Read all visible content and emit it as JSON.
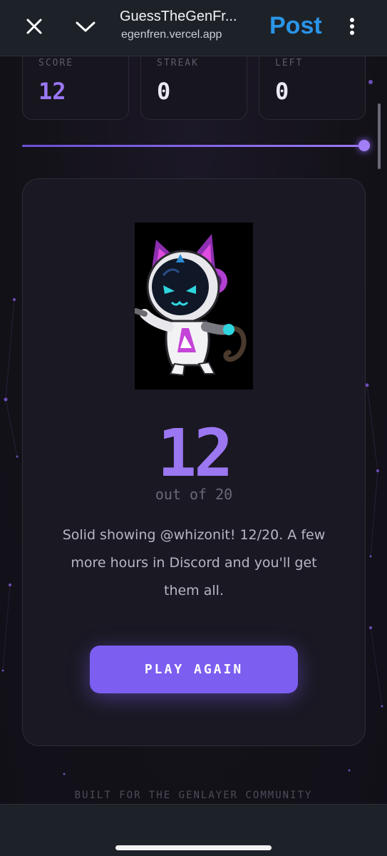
{
  "browser": {
    "title": "GuessTheGenFr...",
    "url": "egenfren.vercel.app",
    "post_label": "Post",
    "icons": [
      "close-icon",
      "chevron-down-icon",
      "more-vert-icon"
    ]
  },
  "stats": [
    {
      "label": "SCORE",
      "value": "12"
    },
    {
      "label": "STREAK",
      "value": "0"
    },
    {
      "label": "LEFT",
      "value": "0"
    }
  ],
  "progress": {
    "fraction": 1.0
  },
  "result": {
    "score": "12",
    "out_of": "out of 20",
    "message": "Solid showing @whizonit! 12/20. A few more hours in Discord and you'll get them all.",
    "button_label": "PLAY AGAIN"
  },
  "footer": {
    "text": "BUILT FOR THE GENLAYER COMMUNITY"
  },
  "colors": {
    "accent": "#9b77f2",
    "button": "#7c5ef0",
    "post_link": "#2a95e8",
    "background": "#14121c"
  }
}
